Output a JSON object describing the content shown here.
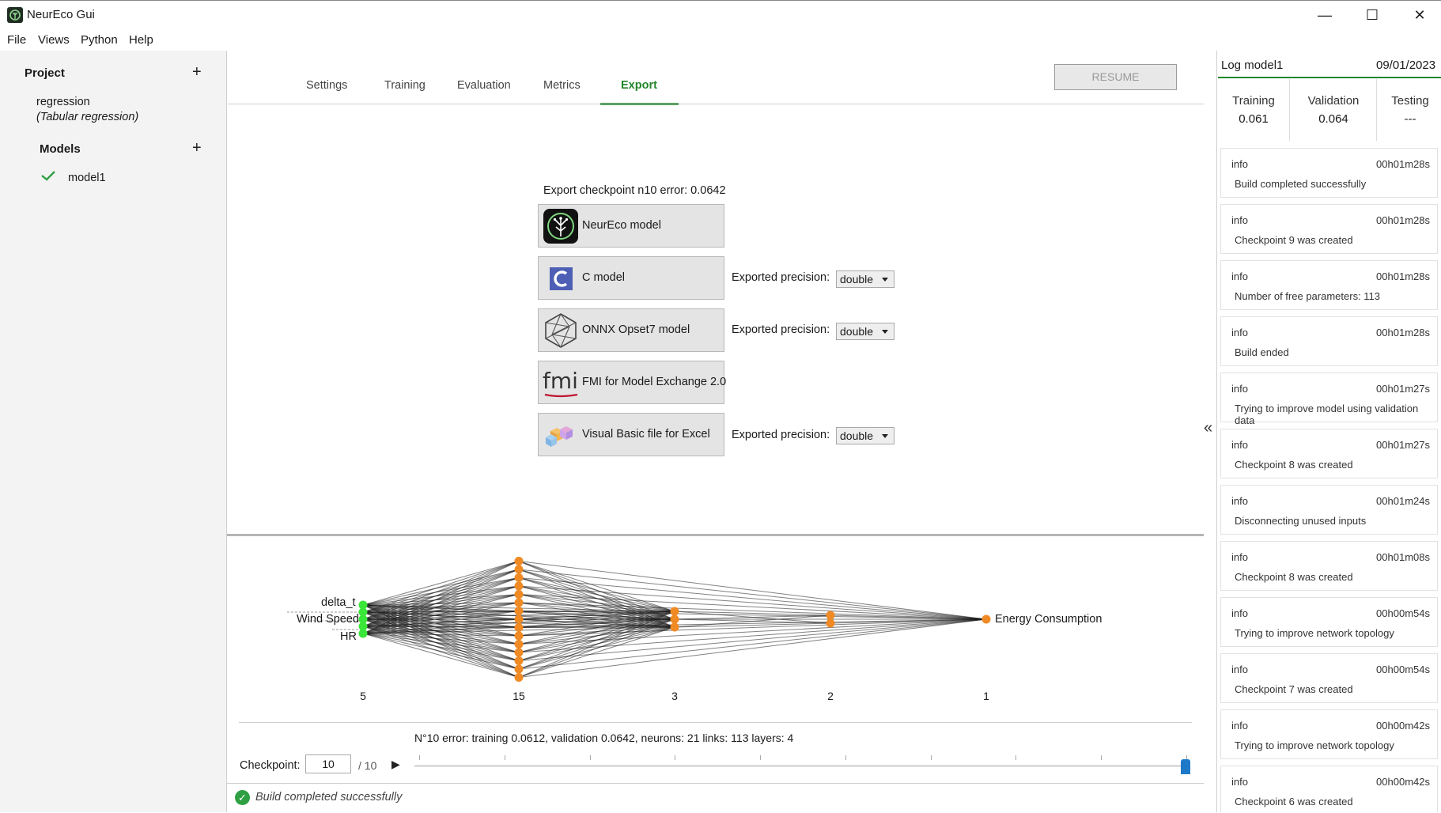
{
  "window": {
    "title": "NeurEco Gui",
    "controls": [
      "—",
      "☐",
      "✕"
    ]
  },
  "menu": [
    "File",
    "Views",
    "Python",
    "Help"
  ],
  "sidebar": {
    "project_heading": "Project",
    "project_name": "regression",
    "project_type": "(Tabular regression)",
    "models_heading": "Models",
    "models": [
      {
        "name": "model1",
        "status": "built"
      }
    ]
  },
  "tabs": [
    "Settings",
    "Training",
    "Evaluation",
    "Metrics",
    "Export"
  ],
  "active_tab": "Export",
  "resume_label": "RESUME",
  "export": {
    "heading": "Export checkpoint n10 error: 0.0642",
    "buttons": [
      {
        "label": "NeurEco model",
        "icon": "neureco-logo-icon"
      },
      {
        "label": "C model",
        "icon": "c-language-icon",
        "precision_label": "Exported precision:",
        "precision": "double"
      },
      {
        "label": "ONNX Opset7 model",
        "icon": "onnx-logo-icon",
        "precision_label": "Exported precision:",
        "precision": "double"
      },
      {
        "label": "FMI for Model Exchange 2.0",
        "icon": "fmi-logo-icon"
      },
      {
        "label": "Visual Basic file for Excel",
        "icon": "cubes-icon",
        "precision_label": "Exported precision:",
        "precision": "double"
      }
    ]
  },
  "network": {
    "inputs": [
      "delta_t",
      "Wind Speed",
      "HR"
    ],
    "output": "Energy Consumption",
    "layer_sizes": [
      "5",
      "15",
      "3",
      "2",
      "1"
    ],
    "input_color": "#39e639",
    "neuron_color": "#f08a24",
    "summary": "N°10 error: training 0.0612, validation 0.0642,  neurons: 21  links: 113  layers: 4"
  },
  "checkpoint": {
    "label": "Checkpoint:",
    "value": "10",
    "total": "/ 10",
    "play_icon": "play-icon",
    "position_fraction": 1.0
  },
  "status_text": "Build completed successfully",
  "log": {
    "title": "Log model1",
    "date": "09/01/2023",
    "metrics": [
      {
        "name": "Training",
        "value": "0.061"
      },
      {
        "name": "Validation",
        "value": "0.064"
      },
      {
        "name": "Testing",
        "value": "---"
      }
    ],
    "entries": [
      {
        "level": "info",
        "time": "00h01m28s",
        "message": "Build completed successfully"
      },
      {
        "level": "info",
        "time": "00h01m28s",
        "message": "Checkpoint 9 was created"
      },
      {
        "level": "info",
        "time": "00h01m28s",
        "message": "Number of free parameters: 113"
      },
      {
        "level": "info",
        "time": "00h01m28s",
        "message": "Build ended"
      },
      {
        "level": "info",
        "time": "00h01m27s",
        "message": "Trying to improve model using validation data"
      },
      {
        "level": "info",
        "time": "00h01m27s",
        "message": "Checkpoint 8 was created"
      },
      {
        "level": "info",
        "time": "00h01m24s",
        "message": "Disconnecting unused inputs"
      },
      {
        "level": "info",
        "time": "00h01m08s",
        "message": "Checkpoint 8 was created"
      },
      {
        "level": "info",
        "time": "00h00m54s",
        "message": "Trying to improve network topology"
      },
      {
        "level": "info",
        "time": "00h00m54s",
        "message": "Checkpoint 7 was created"
      },
      {
        "level": "info",
        "time": "00h00m42s",
        "message": "Trying to improve network topology"
      },
      {
        "level": "info",
        "time": "00h00m42s",
        "message": "Checkpoint 6 was created"
      }
    ]
  },
  "accent_color": "#23862b"
}
